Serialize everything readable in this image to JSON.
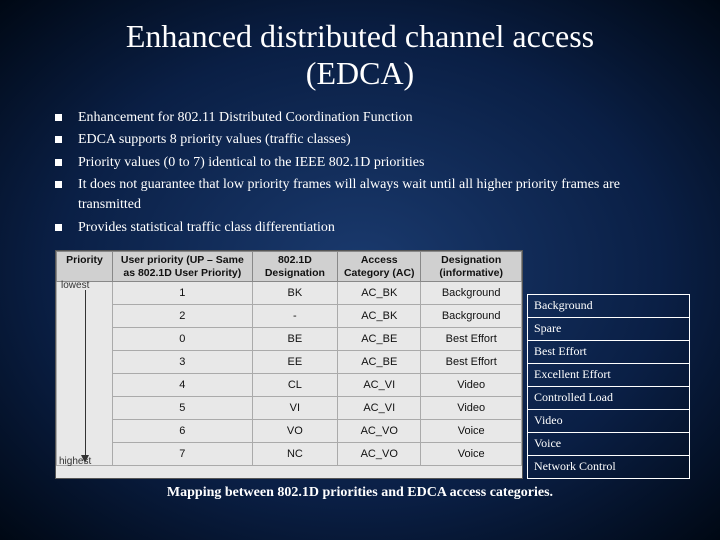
{
  "title_line1": "Enhanced distributed channel access",
  "title_line2": "(EDCA)",
  "bullets": [
    "Enhancement for 802.11 Distributed Coordination Function",
    "EDCA supports 8 priority values (traffic classes)",
    "Priority values (0 to 7) identical to the IEEE 802.1D priorities",
    "It does not guarantee that low priority frames will always wait until all higher priority frames are transmitted",
    "Provides statistical traffic class differentiation"
  ],
  "inner_table": {
    "headers": {
      "priority": "Priority",
      "user_priority": "User priority (UP – Same as 802.1D User Priority)",
      "d8021d": "802.1D Designation",
      "ac": "Access Category (AC)",
      "designation": "Designation (informative)"
    },
    "arrow": {
      "top": "lowest",
      "bottom": "highest"
    },
    "rows": [
      {
        "up": "1",
        "d": "BK",
        "ac": "AC_BK",
        "des": "Background"
      },
      {
        "up": "2",
        "d": "-",
        "ac": "AC_BK",
        "des": "Background"
      },
      {
        "up": "0",
        "d": "BE",
        "ac": "AC_BE",
        "des": "Best Effort"
      },
      {
        "up": "3",
        "d": "EE",
        "ac": "AC_BE",
        "des": "Best Effort"
      },
      {
        "up": "4",
        "d": "CL",
        "ac": "AC_VI",
        "des": "Video"
      },
      {
        "up": "5",
        "d": "VI",
        "ac": "AC_VI",
        "des": "Video"
      },
      {
        "up": "6",
        "d": "VO",
        "ac": "AC_VO",
        "des": "Voice"
      },
      {
        "up": "7",
        "d": "NC",
        "ac": "AC_VO",
        "des": "Voice"
      }
    ]
  },
  "side_labels": [
    "Background",
    "Spare",
    "Best Effort",
    "Excellent Effort",
    "Controlled Load",
    "Video",
    "Voice",
    "Network Control"
  ],
  "caption": "Mapping between 802.1D priorities and EDCA access categories."
}
